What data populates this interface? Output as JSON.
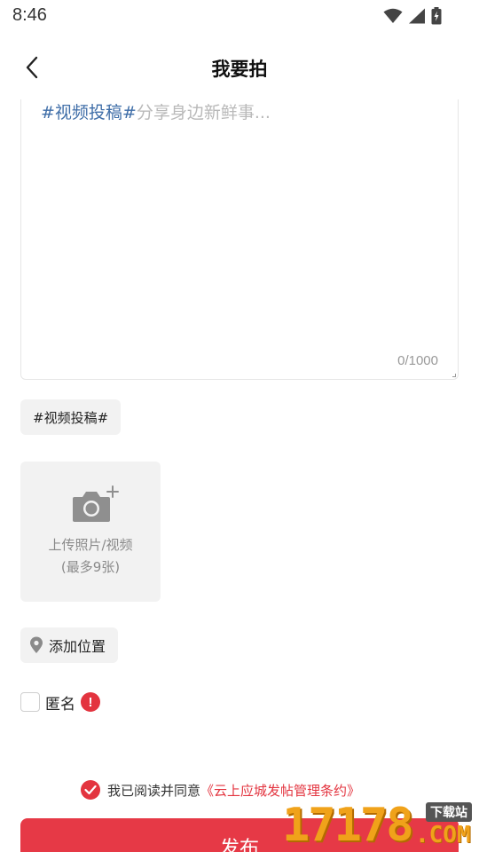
{
  "status_bar": {
    "time": "8:46",
    "icons": [
      "wifi-icon",
      "cell-signal-icon",
      "battery-charging-icon"
    ]
  },
  "nav": {
    "back_icon": "chevron-left-icon",
    "title": "我要拍"
  },
  "editor": {
    "topic": "#视频投稿#",
    "placeholder": "分享身边新鲜事...",
    "counter": "0/1000"
  },
  "topic_chip": {
    "label": "#视频投稿#"
  },
  "upload": {
    "icon": "camera-add-icon",
    "line1": "上传照片/视频",
    "line2": "(最多9张)"
  },
  "location": {
    "icon": "location-pin-icon",
    "label": "添加位置"
  },
  "anonymous": {
    "label": "匿名",
    "checked": false,
    "alert_icon": "exclamation-alert-icon",
    "alert_glyph": "!"
  },
  "agreement": {
    "checked": true,
    "text": "我已阅读并同意",
    "link": "《云上应城发帖管理条约》"
  },
  "publish": {
    "label": "发布"
  },
  "watermark": {
    "digits": "17178",
    "domain": ".COM",
    "badge": "下载站"
  },
  "colors": {
    "accent": "#e63946",
    "topic_blue": "#3f6ea8",
    "chip_bg": "#f2f2f2",
    "watermark_orange": "#f0a21a"
  }
}
